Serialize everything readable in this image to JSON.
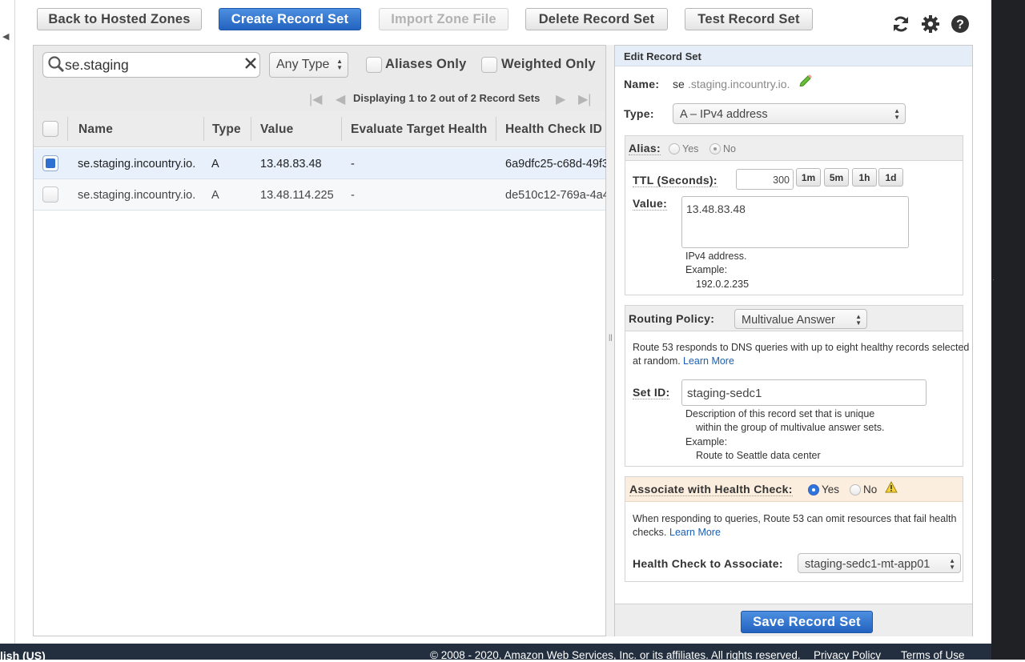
{
  "toolbar": {
    "back": "Back to Hosted Zones",
    "create": "Create Record Set",
    "import": "Import Zone File",
    "delete": "Delete Record Set",
    "test": "Test Record Set",
    "icons": [
      "refresh-icon",
      "gear-icon",
      "help-icon"
    ]
  },
  "filter": {
    "search_value": "se.staging",
    "type_select": "Any Type",
    "aliases_only": "Aliases Only",
    "weighted_only": "Weighted Only",
    "pager_text": "Displaying 1 to 2 out of 2 Record Sets"
  },
  "table": {
    "columns": [
      "Name",
      "Type",
      "Value",
      "Evaluate Target Health",
      "Health Check ID"
    ],
    "rows": [
      {
        "selected": true,
        "name": "se.staging.incountry.io.",
        "type": "A",
        "value": "13.48.83.48",
        "eval": "-",
        "health": "6a9dfc25-c68d-49f3"
      },
      {
        "selected": false,
        "name": "se.staging.incountry.io.",
        "type": "A",
        "value": "13.48.114.225",
        "eval": "-",
        "health": "de510c12-769a-4a4"
      }
    ]
  },
  "edit": {
    "header": "Edit Record Set",
    "name_label": "Name:",
    "name_prefix": "se",
    "name_suffix": ".staging.incountry.io.",
    "type_label": "Type:",
    "type_value": "A – IPv4 address",
    "alias_label": "Alias:",
    "yes": "Yes",
    "no": "No",
    "ttl_label": "TTL (Seconds):",
    "ttl_value": "300",
    "ttl_buttons": [
      "1m",
      "5m",
      "1h",
      "1d"
    ],
    "value_label": "Value:",
    "value_text": "13.48.83.48",
    "value_hint_1": "IPv4 address.",
    "value_hint_2": "Example:",
    "value_hint_3": "192.0.2.235",
    "routing_label": "Routing Policy:",
    "routing_value": "Multivalue Answer",
    "routing_desc": "Route 53 responds to DNS queries with up to eight healthy records selected",
    "routing_desc2": "at random.",
    "learn_more": "Learn More",
    "setid_label": "Set ID:",
    "setid_value": "staging-sedc1",
    "setid_hint_1": "Description of this record set that is unique",
    "setid_hint_2": "within the group of multivalue answer sets.",
    "setid_hint_3": "Example:",
    "setid_hint_4": "Route to Seattle data center",
    "assoc_label": "Associate with Health Check:",
    "assoc_desc": "When responding to queries, Route 53 can omit resources that fail health",
    "assoc_desc2": "checks.",
    "hc_label": "Health Check to Associate:",
    "hc_value": "staging-sedc1-mt-app01",
    "save": "Save Record Set"
  },
  "footer": {
    "language": "lish (US)",
    "copyright": "© 2008 - 2020, Amazon Web Services, Inc. or its affiliates. All rights reserved.",
    "privacy": "Privacy Policy",
    "terms": "Terms of Use"
  },
  "colors": {
    "primary": "#2a6fd0",
    "link": "#1a5fb4",
    "footer": "#232f3e",
    "selected_row": "#e8f0fb"
  }
}
